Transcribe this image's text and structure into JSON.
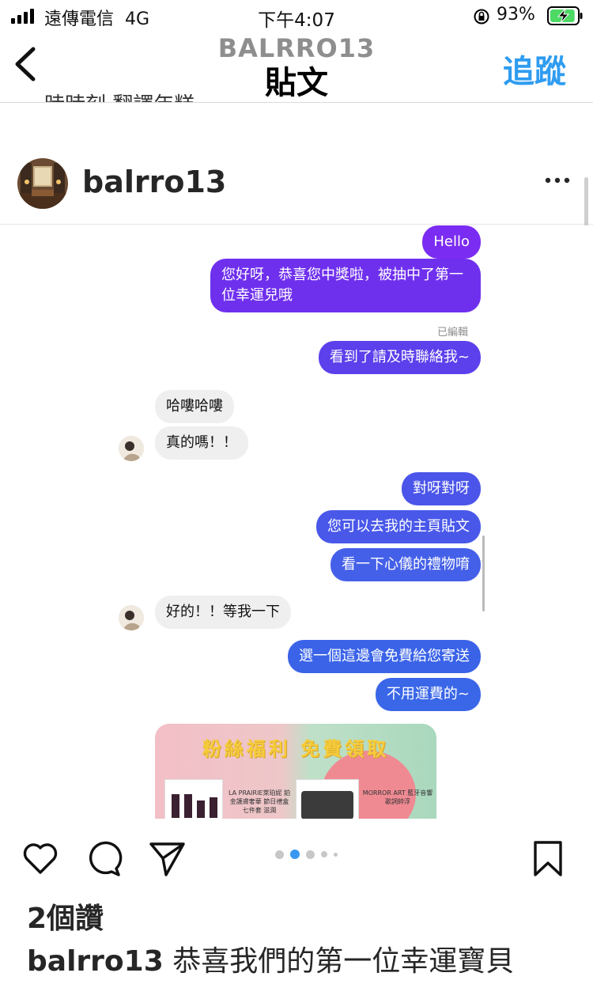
{
  "status_bar": {
    "carrier": "遠傳電信",
    "network": "4G",
    "time": "下午4:07",
    "battery_percent": "93%",
    "battery_level": 0.93
  },
  "header": {
    "username": "BALRRO13",
    "title": "貼文",
    "follow_label": "追蹤",
    "peek_text": "…時時刻 翻譯年糕"
  },
  "post": {
    "username": "balrro13"
  },
  "chat": {
    "messages": [
      {
        "side": "out",
        "text": "Hello"
      },
      {
        "side": "out",
        "text": "您好呀，恭喜您中獎啦，被抽中了第一位幸運兒哦"
      },
      {
        "side": "out",
        "text": "看到了請及時聯絡我~"
      },
      {
        "side": "in",
        "text": "哈嘍哈嘍"
      },
      {
        "side": "in",
        "text": "真的嗎！！"
      },
      {
        "side": "out",
        "text": "對呀對呀"
      },
      {
        "side": "out",
        "text": "您可以去我的主頁貼文"
      },
      {
        "side": "out",
        "text": "看一下心儀的禮物唷"
      },
      {
        "side": "in",
        "text": "好的！！等我一下"
      },
      {
        "side": "out",
        "text": "選一個這邊會免費給您寄送"
      },
      {
        "side": "out",
        "text": "不用運費的~"
      }
    ],
    "edited_label": "已編輯",
    "promo": {
      "title": "粉絲福利 免費領取",
      "item1": "LA PRAIRIE萊珀妮 鉑金護膚奢華 節日禮盒七件套 滋潤",
      "item2": "MORROR ART 藍牙音響 歌詞帥浮"
    }
  },
  "carousel": {
    "count": 5,
    "active_index": 1
  },
  "likes": {
    "text": "2個讚"
  },
  "caption": {
    "username": "balrro13",
    "text": "恭喜我們的第一位幸運寶貝"
  },
  "colors": {
    "follow_blue": "#2f9cf0",
    "bubble_purple": "#7b2cf2",
    "bubble_blue": "#3a63e8",
    "bubble_gray": "#efefef"
  }
}
